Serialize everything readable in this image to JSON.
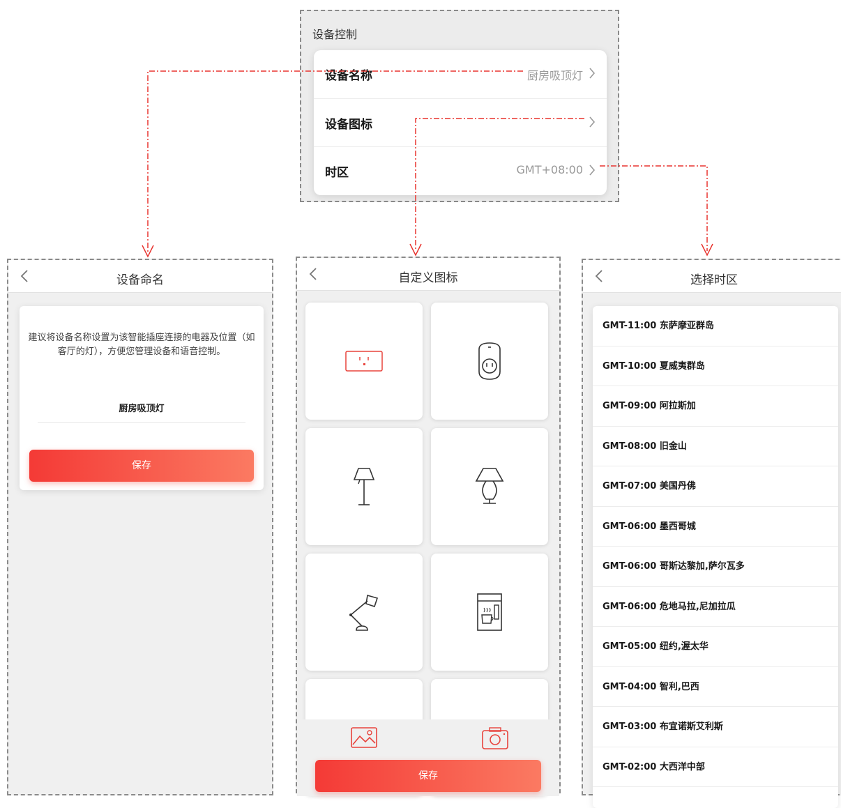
{
  "settings": {
    "title": "设备控制",
    "rows": [
      {
        "label": "设备名称",
        "value": "厨房吸顶灯"
      },
      {
        "label": "设备图标",
        "value": ""
      },
      {
        "label": "时区",
        "value": "GMT+08:00"
      }
    ]
  },
  "naming": {
    "title": "设备命名",
    "hint": "建议将设备名称设置为该智能插座连接的电器及位置（如客厅的灯），方便您管理设备和语音控制。",
    "name_value": "厨房吸顶灯",
    "save_label": "保存"
  },
  "icons": {
    "title": "自定义图标",
    "tiles": [
      "socket-icon",
      "plug-icon",
      "floor-lamp-icon",
      "table-lamp-icon",
      "desk-lamp-icon",
      "coffee-machine-icon",
      "more-icon",
      "more-icon"
    ],
    "save_label": "保存",
    "gallery_icon": "gallery-icon",
    "camera_icon": "camera-icon"
  },
  "timezone": {
    "title": "选择时区",
    "items": [
      "GMT-11:00 东萨摩亚群岛",
      "GMT-10:00 夏威夷群岛",
      "GMT-09:00 阿拉斯加",
      "GMT-08:00 旧金山",
      "GMT-07:00 美国丹佛",
      "GMT-06:00 墨西哥城",
      "GMT-06:00 哥斯达黎加,萨尔瓦多",
      "GMT-06:00 危地马拉,尼加拉瓜",
      "GMT-05:00 纽约,渥太华",
      "GMT-04:00 智利,巴西",
      "GMT-03:00 布宜诺斯艾利斯",
      "GMT-02:00 大西洋中部"
    ]
  },
  "colors": {
    "accent": "#f43a36",
    "connector": "#e8332e"
  }
}
